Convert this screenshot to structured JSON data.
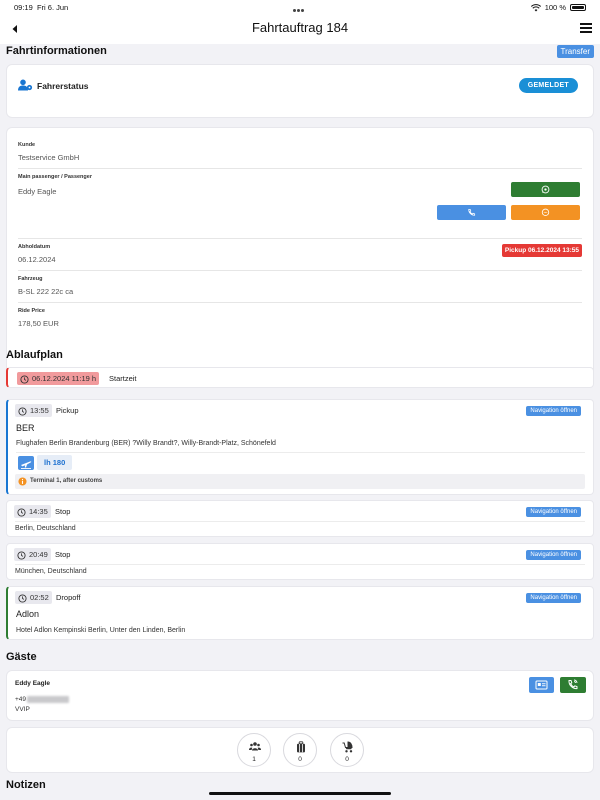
{
  "status": {
    "time": "09:19",
    "date": "Fri 6. Jun",
    "battery": "100 %"
  },
  "header": {
    "title": "Fahrtauftrag 184"
  },
  "info": {
    "section_title": "Fahrtinformationen",
    "transfer_label": "Transfer",
    "driver_status_label": "Fahrerstatus",
    "driver_status_value": "GEMELDET",
    "customer_label": "Kunde",
    "customer_value": "Testservice GmbH",
    "passenger_label": "Main passenger / Passenger",
    "passenger_value": "Eddy Eagle",
    "pickup_date_label": "Abholdatum",
    "pickup_date_value": "06.12.2024",
    "pickup_badge": "Pickup 06.12.2024 13:55",
    "vehicle_label": "Fahrzeug",
    "vehicle_value": "B-SL 222 22c ca",
    "price_label": "Ride Price",
    "price_value": "178,50 EUR"
  },
  "plan": {
    "section_title": "Ablaufplan",
    "start_time": "06.12.2024 11:19 h",
    "start_label": "Startzeit",
    "nav_label": "Navigation öffnen",
    "stops": [
      {
        "time": "13:55",
        "type": "Pickup",
        "name": "BER",
        "address": "Flughafen Berlin Brandenburg (BER) ?Willy Brandt?, Willy-Brandt-Platz, Schönefeld",
        "flight": "lh 180",
        "note": "Terminal 1, after customs"
      },
      {
        "time": "14:35",
        "type": "Stop",
        "address": "Berlin, Deutschland"
      },
      {
        "time": "20:49",
        "type": "Stop",
        "address": "München, Deutschland"
      },
      {
        "time": "02:52",
        "type": "Dropoff",
        "name": "Adlon",
        "address": "Hotel Adlon Kempinski Berlin, Unter den Linden, Berlin"
      }
    ]
  },
  "guests": {
    "section_title": "Gäste",
    "name": "Eddy Eagle",
    "phone_prefix": "+49",
    "tag": "VVIP",
    "counts": {
      "persons": "1",
      "luggage": "0",
      "strollers": "0"
    }
  },
  "notes": {
    "section_title": "Notizen"
  },
  "colors": {
    "primary": "#4a90e2",
    "whatsapp": "#2e7d32",
    "sms": "#f39223",
    "danger": "#e53935",
    "status": "#1a8fd6"
  }
}
